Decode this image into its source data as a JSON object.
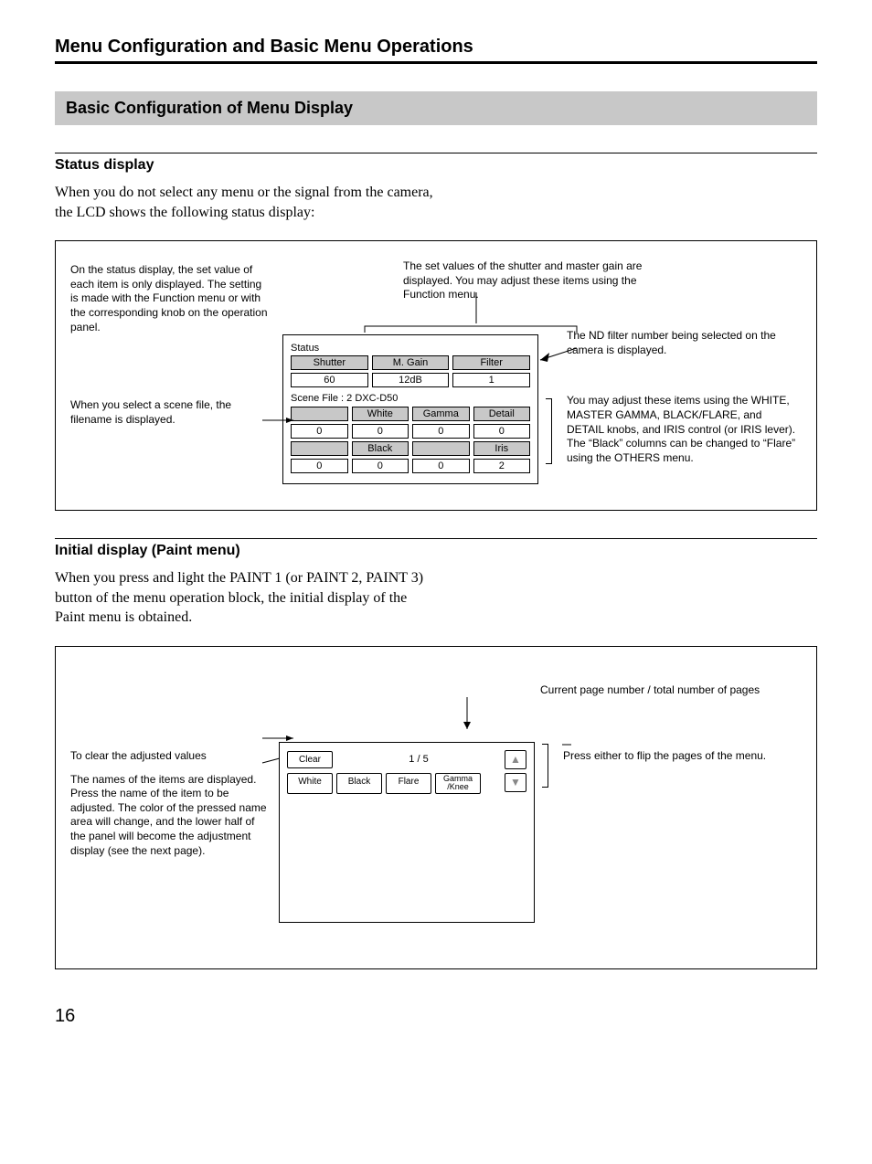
{
  "chapter_title": "Menu Configuration and Basic Menu Operations",
  "section_title": "Basic Configuration of Menu Display",
  "status": {
    "heading": "Status display",
    "body": "When you do not select any menu or the signal from the camera, the LCD shows the following status display:",
    "note_left_top": "On the status display, the set value of each item is only displayed.  The setting is made with the Function menu or with the corresponding knob on the operation panel.",
    "note_scene": "When you select a scene file, the filename is displayed.",
    "note_top_center": "The set values of the shutter and master gain are displayed.  You may adjust these items using the Function menu.",
    "note_nd": "The ND filter number being selected on the camera is displayed.",
    "note_right_adjust": "You may adjust these items using the WHITE, MASTER GAMMA, BLACK/FLARE, and DETAIL knobs, and IRIS control (or IRIS lever).\nThe “Black” columns can be changed to “Flare” using the OTHERS menu.",
    "lcd": {
      "title": "Status",
      "row1_headers": [
        "Shutter",
        "M. Gain",
        "Filter"
      ],
      "row1_values": [
        "60",
        "12dB",
        "1"
      ],
      "scene_file": "Scene File : 2 DXC-D50",
      "row2_headers": [
        "",
        "White",
        "Gamma",
        "Detail"
      ],
      "row2_values": [
        "0",
        "0",
        "0",
        "0"
      ],
      "row3_headers": [
        "",
        "Black",
        "",
        "Iris"
      ],
      "row3_values": [
        "0",
        "0",
        "0",
        "2"
      ]
    }
  },
  "initial": {
    "heading": "Initial display (Paint menu)",
    "body": "When you press and light the PAINT 1 (or PAINT 2, PAINT 3) button of the menu operation block, the initial display of the Paint menu is obtained.",
    "note_top": "Current page number / total number of pages",
    "note_clear": "To clear the adjusted values",
    "note_items": "The names of the items are displayed.  Press the name of the item to be adjusted.  The color of the pressed name area will change, and the lower half of the panel will become the adjustment display (see the next page).",
    "note_flip": "Press either to flip the pages of the menu.",
    "lcd": {
      "clear": "Clear",
      "page": "1 / 5",
      "up": "▲",
      "down": "▼",
      "items": [
        "White",
        "Black",
        "Flare",
        "Gamma\n/Knee"
      ]
    }
  },
  "page_number": "16"
}
